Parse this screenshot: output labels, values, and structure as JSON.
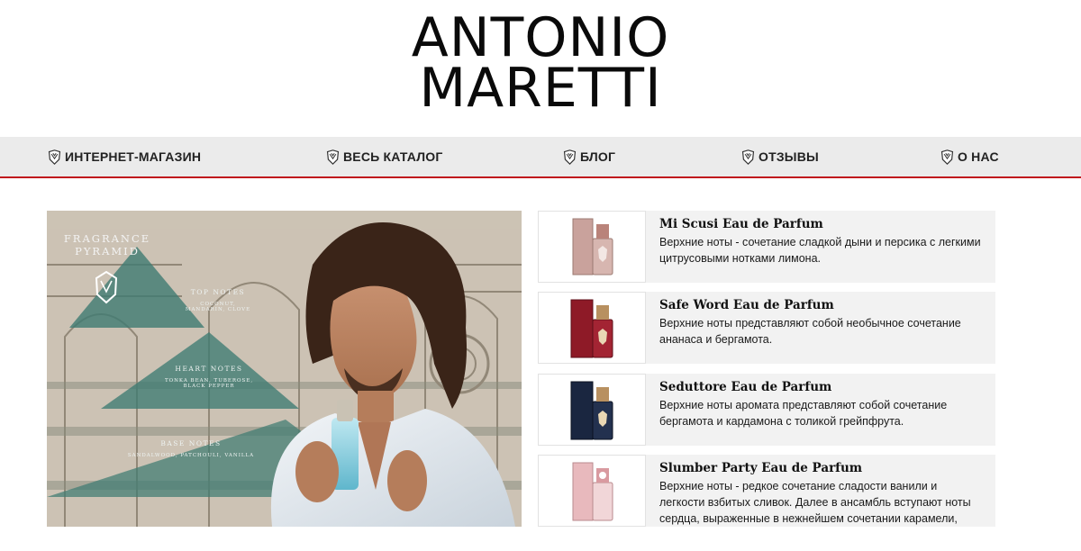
{
  "logo": {
    "line1": "ANTONIO",
    "line2": "MARETTI"
  },
  "nav": [
    {
      "label": "ИНТЕРНЕТ-МАГАЗИН"
    },
    {
      "label": "ВЕСЬ КАТАЛОГ"
    },
    {
      "label": "БЛОГ"
    },
    {
      "label": "ОТЗЫВЫ"
    },
    {
      "label": "О НАС"
    }
  ],
  "hero": {
    "title_line1": "FRAGRANCE",
    "title_line2": "PYRAMID",
    "top_notes_title": "TOP NOTES",
    "top_notes_line1": "COCONUT,",
    "top_notes_line2": "MANDARIN, CLOVE",
    "heart_notes_title": "HEART NOTES",
    "heart_notes_line1": "TONKA BEAN, TUBEROSE,",
    "heart_notes_line2": "BLACK PEPPER",
    "base_notes_title": "BASE NOTES",
    "base_notes_line1": "SANDALWOOD, PATCHOULI, VANILLA"
  },
  "products": [
    {
      "name": "Mi Scusi Eau de Parfum",
      "desc_line1": "Верхние ноты - сочетание сладкой дыни и персика с легкими",
      "desc_line2": "цитрусовыми нотками лимона.",
      "box_color": "#c9a29c",
      "cap_color": "#b9837a"
    },
    {
      "name": "Safe Word Eau de Parfum",
      "desc_line1": "Верхние ноты представляют собой необычное сочетание",
      "desc_line2": "ананаса и бергамота.",
      "box_color": "#8e1a27",
      "cap_color": "#a32433"
    },
    {
      "name": "Seduttore Eau de Parfum",
      "desc_line1": "Верхние ноты аромата представляют собой сочетание",
      "desc_line2": "бергамота и кардамона с толикой грейпфрута.",
      "box_color": "#1a2640",
      "cap_color": "#23314f"
    },
    {
      "name": "Slumber Party Eau de Parfum",
      "desc_line1": "Верхние ноты - редкое сочетание сладости ванили и",
      "desc_line2": "легкости взбитых сливок. Далее в ансамбль вступают ноты",
      "desc_line3": "сердца, выраженные в нежнейшем сочетании карамели,",
      "box_color": "#e8b9bd",
      "cap_color": "#d99aa0"
    }
  ],
  "colors": {
    "accent": "#c0171c",
    "navbar_bg": "#ebebeb",
    "card_bg": "#f2f2f2"
  }
}
